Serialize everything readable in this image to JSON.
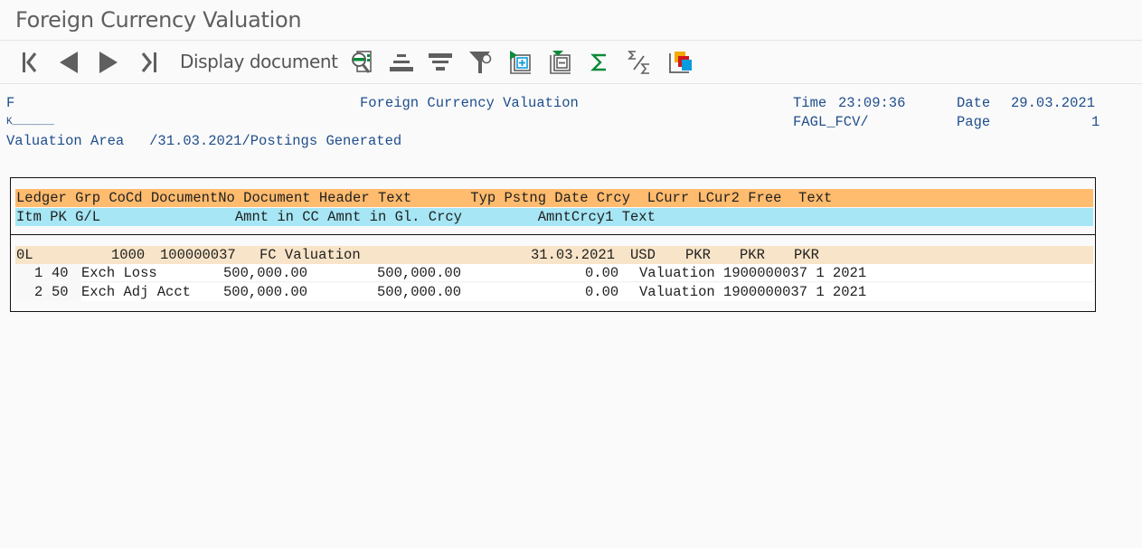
{
  "window": {
    "title": "Foreign Currency Valuation"
  },
  "toolbar": {
    "buttons": [
      {
        "name": "first-page",
        "icon": "first-page-icon"
      },
      {
        "name": "previous-page",
        "icon": "previous-page-icon"
      },
      {
        "name": "next-page",
        "icon": "next-page-icon"
      },
      {
        "name": "last-page",
        "icon": "last-page-icon"
      }
    ],
    "display_document_label": "Display document",
    "icons": [
      "detail-view-icon",
      "sort-ascending-icon",
      "sort-descending-icon",
      "filter-icon",
      "expand-icon",
      "collapse-icon",
      "total-icon",
      "subtotal-icon",
      "layout-icon"
    ],
    "colors": {
      "icon_gray": "#5f5f5f",
      "accent_green": "#0a8a3a",
      "accent_blue": "#0a9bdc"
    }
  },
  "report_header": {
    "line1_left": "F",
    "line1_center": "Foreign Currency Valuation",
    "time_label": "Time",
    "time_value": "23:09:36",
    "date_label": "Date",
    "date_value": "29.03.2021",
    "line2_left": "K_______",
    "program": "FAGL_FCV/",
    "page_label": "Page",
    "page_value": "1",
    "line3": "Valuation Area   /31.03.2021/Postings Generated"
  },
  "table": {
    "header_row1": "Ledger Grp CoCd DocumentNo Document Header Text       Typ Pstng Date Crcy  LCurr LCur2 Free  Text",
    "header_row2": "Itm PK G/L                Amnt in CC Amnt in Gl. Crcy         AmntCrcy1 Text",
    "document": {
      "ledger": "0L",
      "cocd": "1000",
      "document_no": "100000037",
      "header_text": "FC Valuation",
      "posting_date": "31.03.2021",
      "crcy": "USD",
      "lcurr": "PKR",
      "lcur2": "PKR",
      "free": "PKR"
    },
    "items": [
      {
        "itm": "1",
        "pk": "40",
        "gl": "Exch Loss",
        "amnt_cc": "500,000.00",
        "amnt_gl": "500,000.00",
        "amnt_crcy1": "0.00",
        "text": "Valuation 1900000037 1 2021"
      },
      {
        "itm": "2",
        "pk": "50",
        "gl": "Exch Adj Acct",
        "amnt_cc": "500,000.00",
        "amnt_gl": "500,000.00",
        "amnt_crcy1": "0.00",
        "text": "Valuation 1900000037 1 2021"
      }
    ],
    "colors": {
      "header1": "#ffbb6e",
      "header2": "#a6e6f5",
      "document_row": "#f8e4c8",
      "item_row": "#ffffff"
    }
  }
}
